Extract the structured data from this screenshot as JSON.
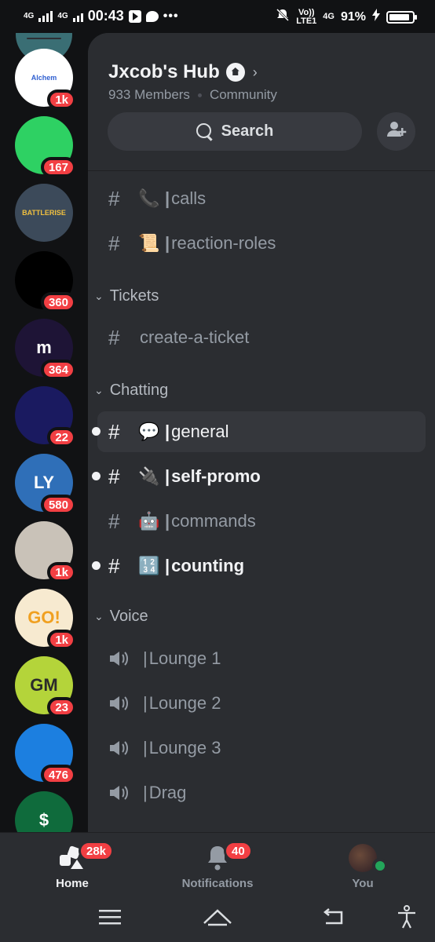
{
  "status_bar": {
    "network_left": "4G",
    "network_right": "4G",
    "time": "00:43",
    "more": "•••",
    "carrier_top": "Vo))",
    "carrier_bottom": "LTE1",
    "network_4g": "4G",
    "battery_percent": "91%",
    "battery_level": 0.91
  },
  "servers": [
    {
      "name": "Alchemy",
      "initials": "Alchem",
      "badge": "1k",
      "bg": "#ffffff",
      "fg": "#2f5fd0"
    },
    {
      "name": "Green server",
      "initials": "",
      "badge": "167",
      "bg": "#2ed163",
      "fg": "#ffffff"
    },
    {
      "name": "Battlerise",
      "initials": "BATTLERISE",
      "badge": "",
      "bg": "#3c4a5a",
      "fg": "#f0c040"
    },
    {
      "name": "Black server",
      "initials": "",
      "badge": "360",
      "bg": "#000000",
      "fg": "#ffffff"
    },
    {
      "name": "M server",
      "initials": "m",
      "badge": "364",
      "bg": "#1e1436",
      "fg": "#ffffff"
    },
    {
      "name": "Blue ring server",
      "initials": "",
      "badge": "22",
      "bg": "#1a1a60",
      "fg": "#3344ff"
    },
    {
      "name": "Streamer server",
      "initials": "LY",
      "badge": "580",
      "bg": "#2f6fb8",
      "fg": "#ffffff"
    },
    {
      "name": "Face server",
      "initials": "",
      "badge": "1k",
      "bg": "#c9c2b8",
      "fg": "#3b2a20"
    },
    {
      "name": "GO! server",
      "initials": "GO!",
      "badge": "1k",
      "bg": "#f7ead0",
      "fg": "#f0a020"
    },
    {
      "name": "GM server",
      "initials": "GM",
      "badge": "23",
      "bg": "#b4d43a",
      "fg": "#2b2b2b"
    },
    {
      "name": "Wave server",
      "initials": "",
      "badge": "476",
      "bg": "#1c7fe0",
      "fg": "#ffffff"
    },
    {
      "name": "Dollar server",
      "initials": "$",
      "badge": "",
      "bg": "#0f6b3c",
      "fg": "#ffffff"
    }
  ],
  "server": {
    "name": "Jxcob's Hub",
    "members": "933 Members",
    "type": "Community"
  },
  "search": {
    "label": "Search"
  },
  "channels_top": [
    {
      "name": "calls",
      "emoji": "📞",
      "state": "muted"
    },
    {
      "name": "reaction-roles",
      "emoji": "📜",
      "state": "muted"
    }
  ],
  "categories": {
    "tickets": "Tickets",
    "chatting": "Chatting",
    "voice": "Voice"
  },
  "tickets_channels": [
    {
      "name": "create-a-ticket",
      "emoji": "",
      "state": "muted"
    }
  ],
  "chatting_channels": [
    {
      "name": "general",
      "emoji": "💬",
      "state": "active"
    },
    {
      "name": "self-promo",
      "emoji": "🔌",
      "state": "unread"
    },
    {
      "name": "commands",
      "emoji": "🤖",
      "state": "muted"
    },
    {
      "name": "counting",
      "emoji": "🔢",
      "state": "unread"
    }
  ],
  "voice_channels": [
    {
      "name": "Lounge 1"
    },
    {
      "name": "Lounge 2"
    },
    {
      "name": "Lounge 3"
    },
    {
      "name": "Drag"
    }
  ],
  "bottom_nav": {
    "home": {
      "label": "Home",
      "badge": "28k"
    },
    "notifications": {
      "label": "Notifications",
      "badge": "40"
    },
    "you": {
      "label": "You"
    }
  },
  "colors": {
    "badge": "#f23f43",
    "online": "#23a55a",
    "panel": "#2b2d31",
    "rail": "#111214"
  }
}
